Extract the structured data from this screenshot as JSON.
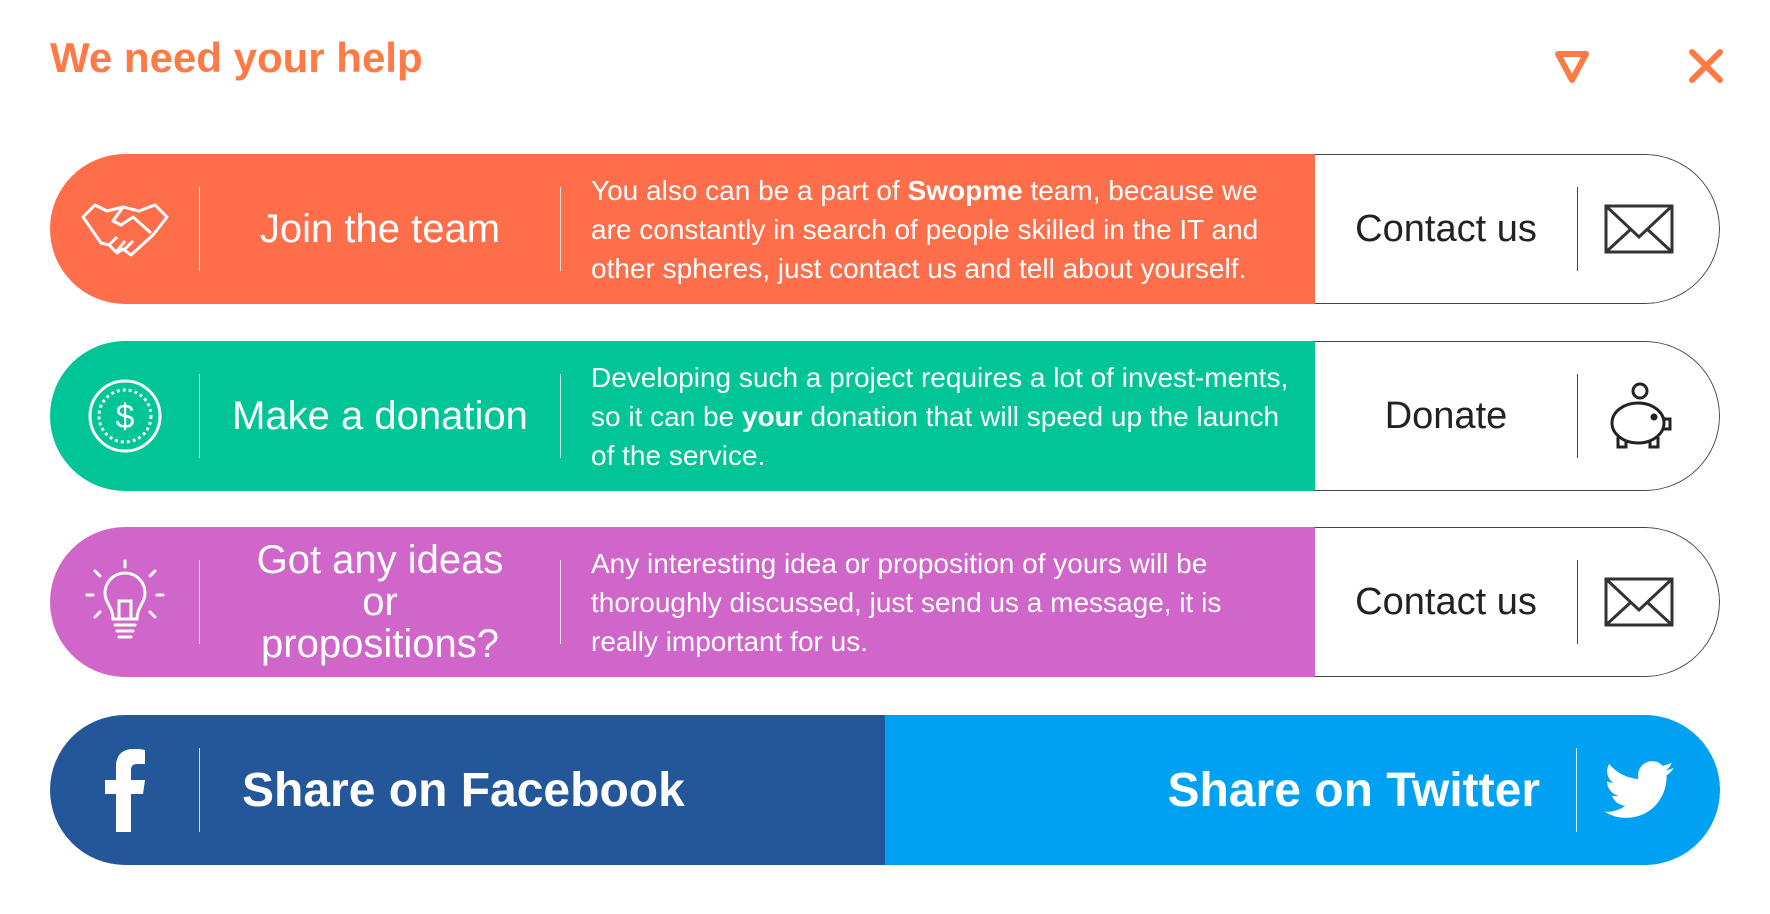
{
  "header": {
    "title": "We need your help"
  },
  "rows": [
    {
      "label": "Join the team",
      "desc_before": "You also can be a part of ",
      "desc_bold": "Swopme",
      "desc_after": " team, because we are constantly in search of people skilled in the IT and other spheres, just contact us and tell about yourself.",
      "action": "Contact us",
      "color": "#ff6e4a"
    },
    {
      "label": "Make a donation",
      "desc_before": "Developing such a project requires a lot of invest-ments, so it can be ",
      "desc_bold": "your",
      "desc_after": " donation that will speed up the launch of the service.",
      "action": "Donate",
      "color": "#00c597"
    },
    {
      "label": "Got any ideas or propositions?",
      "desc_before": "Any interesting idea or proposition of yours will be thoroughly discussed, just send us a message, it is really important for us.",
      "desc_bold": "",
      "desc_after": "",
      "action": "Contact us",
      "color": "#d066c9"
    }
  ],
  "share": {
    "facebook": "Share on Facebook",
    "twitter": "Share on Twitter"
  }
}
